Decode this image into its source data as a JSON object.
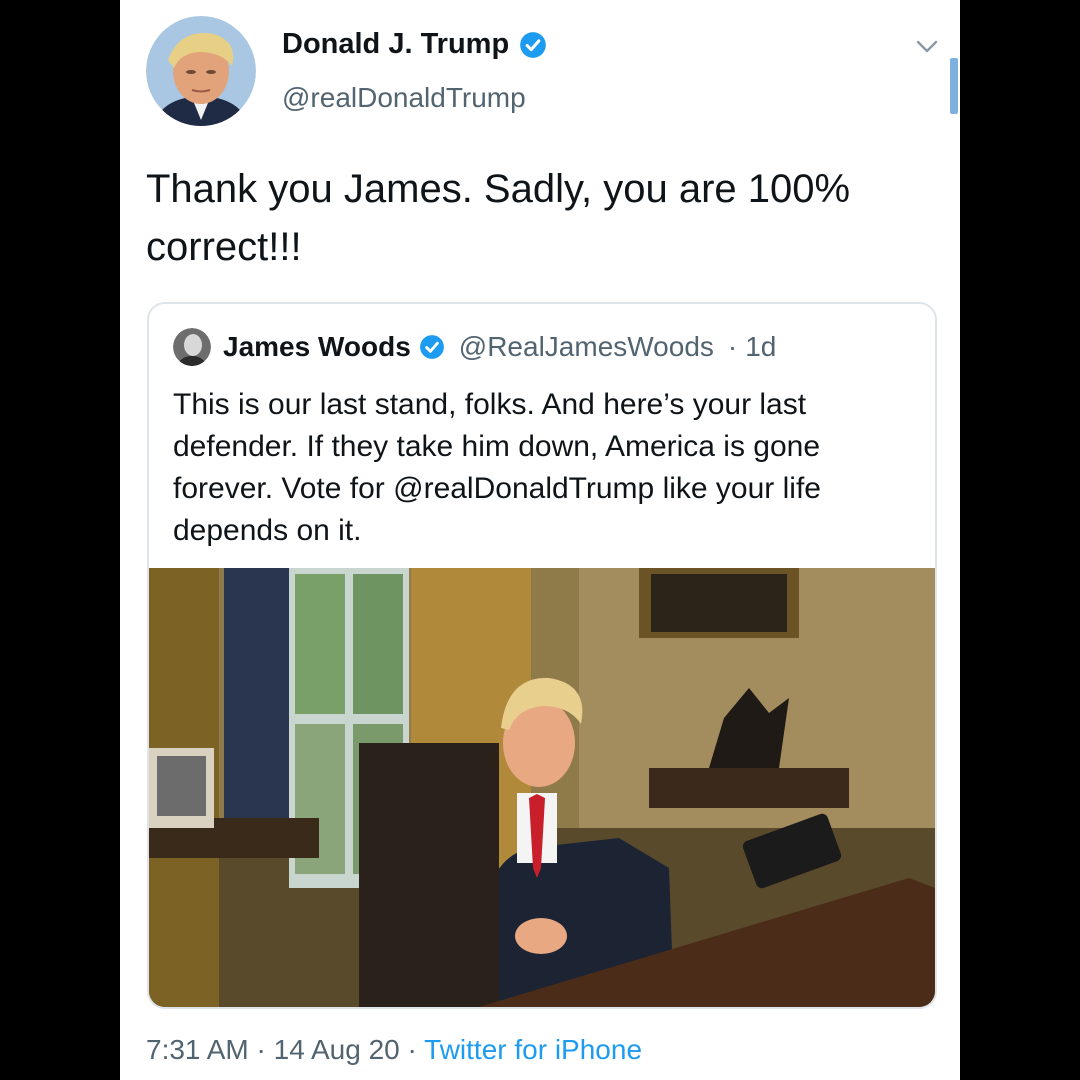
{
  "tweet": {
    "author_name": "Donald J. Trump",
    "author_handle": "@realDonaldTrump",
    "text": "Thank you James. Sadly, you are 100% correct!!!",
    "menu_icon": "chevron-down-icon"
  },
  "quoted_tweet": {
    "author_name": "James Woods",
    "author_handle": "@RealJamesWoods",
    "separator": "·",
    "age": "1d",
    "text": "This is our last stand, folks. And here’s your last defender. If they take him down, America is gone forever. Vote for @realDonaldTrump like your life depends on it."
  },
  "footer": {
    "time": "7:31 AM",
    "sep1": "·",
    "date": "14 Aug 20",
    "sep2": "·",
    "source": "Twitter for iPhone"
  },
  "colors": {
    "verified_badge": "#1d9bf0",
    "link": "#1d9bf0",
    "secondary_text": "#536471"
  }
}
